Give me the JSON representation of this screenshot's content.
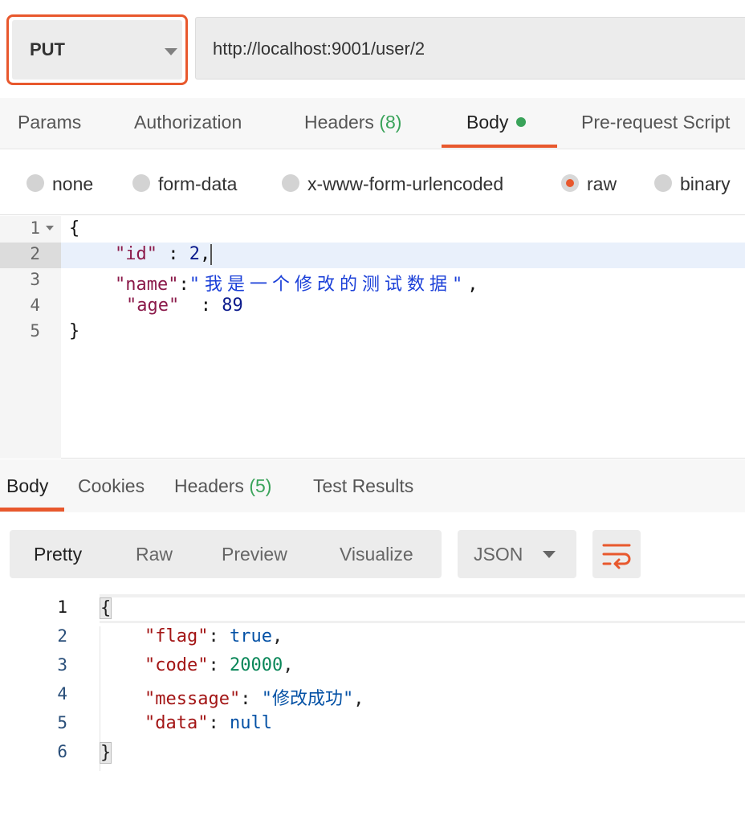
{
  "request": {
    "method": "PUT",
    "url": "http://localhost:9001/user/2"
  },
  "request_tabs": [
    {
      "label": "Params"
    },
    {
      "label": "Authorization"
    },
    {
      "label": "Headers",
      "count": "(8)"
    },
    {
      "label": "Body",
      "active": true
    },
    {
      "label": "Pre-request Script"
    }
  ],
  "body_types": [
    {
      "label": "none"
    },
    {
      "label": "form-data"
    },
    {
      "label": "x-www-form-urlencoded"
    },
    {
      "label": "raw",
      "selected": true
    },
    {
      "label": "binary"
    }
  ],
  "request_body": {
    "line_numbers": [
      "1",
      "2",
      "3",
      "4",
      "5"
    ],
    "lines": {
      "l1": "{",
      "l2_key": "\"id\"",
      "l2_sep": " : ",
      "l2_val": "2",
      "l2_end": ",",
      "l3_key": "\"name\"",
      "l3_sep": ":",
      "l3_val": "\"我是一个修改的测试数据\"",
      "l3_end": ",",
      "l4_key": "\"age\"",
      "l4_sep": "  : ",
      "l4_val": "89",
      "l5": "}"
    }
  },
  "response_tabs": [
    {
      "label": "Body",
      "active": true
    },
    {
      "label": "Cookies"
    },
    {
      "label": "Headers",
      "count": "(5)"
    },
    {
      "label": "Test Results"
    }
  ],
  "response_toolbar": {
    "views": [
      "Pretty",
      "Raw",
      "Preview",
      "Visualize"
    ],
    "active_view": "Pretty",
    "format": "JSON"
  },
  "response_body": {
    "line_numbers": [
      "1",
      "2",
      "3",
      "4",
      "5",
      "6"
    ],
    "open": "{",
    "flag_key": "\"flag\"",
    "flag_val": "true",
    "code_key": "\"code\"",
    "code_val": "20000",
    "message_key": "\"message\"",
    "message_val": "\"修改成功\"",
    "data_key": "\"data\"",
    "data_val": "null",
    "close": "}"
  },
  "colors": {
    "accent": "#e8582d",
    "success": "#3aa35a"
  }
}
